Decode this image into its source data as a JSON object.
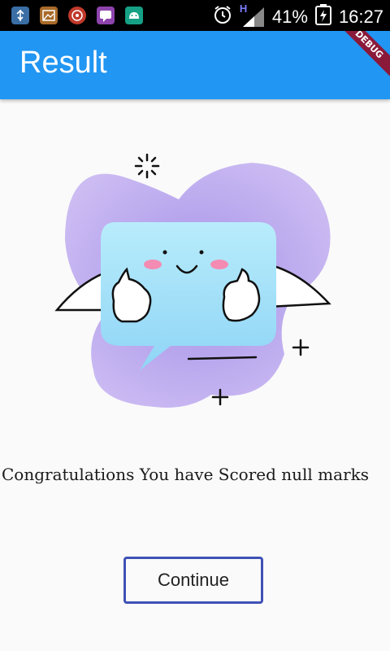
{
  "status_bar": {
    "notifications": [
      "usb-icon",
      "gallery-icon",
      "music-icon",
      "chat-icon",
      "android-icon"
    ],
    "network": "H",
    "battery": "41%",
    "time": "16:27"
  },
  "app_bar": {
    "title": "Result",
    "debug_banner": "DEBUG",
    "color": "#2196f3"
  },
  "content": {
    "message": "Congratulations You have Scored null marks",
    "continue_label": "Continue",
    "button_border_color": "#3f51b5"
  }
}
